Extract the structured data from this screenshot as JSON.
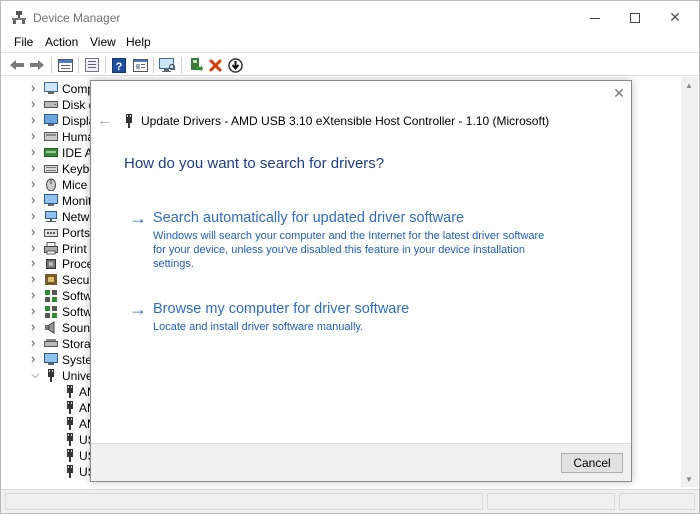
{
  "window": {
    "title": "Device Manager"
  },
  "menu": [
    "File",
    "Action",
    "View",
    "Help"
  ],
  "toolbar": {
    "icons": [
      "back-icon",
      "forward-icon",
      "properties-icon",
      "show-hidden-icon",
      "help-icon",
      "view-icon",
      "monitor-scan-icon",
      "enable-device-icon",
      "uninstall-icon",
      "update-driver-icon"
    ],
    "colors": {
      "uninstall": "#d83b01",
      "enable": "#2e8b2e",
      "help": "#1f4e9c"
    }
  },
  "tree": {
    "items": [
      {
        "label": "Comp",
        "icon": "computer-icon",
        "expanded": false
      },
      {
        "label": "Disk d",
        "icon": "disk-icon",
        "expanded": false
      },
      {
        "label": "Displa",
        "icon": "display-icon",
        "expanded": false
      },
      {
        "label": "Huma",
        "icon": "hid-icon",
        "expanded": false
      },
      {
        "label": "IDE AT",
        "icon": "ide-icon",
        "expanded": false
      },
      {
        "label": "Keybo",
        "icon": "keyboard-icon",
        "expanded": false
      },
      {
        "label": "Mice a",
        "icon": "mouse-icon",
        "expanded": false
      },
      {
        "label": "Monit",
        "icon": "monitor-icon",
        "expanded": false
      },
      {
        "label": "Netwo",
        "icon": "network-icon",
        "expanded": false
      },
      {
        "label": "Ports (",
        "icon": "port-icon",
        "expanded": false
      },
      {
        "label": "Print q",
        "icon": "printer-icon",
        "expanded": false
      },
      {
        "label": "Proces",
        "icon": "processor-icon",
        "expanded": false
      },
      {
        "label": "Securi",
        "icon": "security-icon",
        "expanded": false
      },
      {
        "label": "Softwa",
        "icon": "software-icon",
        "expanded": false
      },
      {
        "label": "Softwa",
        "icon": "software-icon",
        "expanded": false
      },
      {
        "label": "Sound",
        "icon": "sound-icon",
        "expanded": false
      },
      {
        "label": "Storag",
        "icon": "storage-icon",
        "expanded": false
      },
      {
        "label": "System",
        "icon": "system-icon",
        "expanded": false
      },
      {
        "label": "Univer",
        "icon": "usb-icon",
        "expanded": true
      }
    ],
    "children": [
      "AM",
      "AM",
      "AM",
      "US",
      "US",
      "US"
    ]
  },
  "dialog": {
    "title": "Update Drivers - AMD USB 3.10 eXtensible Host Controller - 1.10 (Microsoft)",
    "heading": "How do you want to search for drivers?",
    "options": [
      {
        "title": "Search automatically for updated driver software",
        "description": "Windows will search your computer and the Internet for the latest driver software for your device, unless you've disabled this feature in your device installation settings."
      },
      {
        "title": "Browse my computer for driver software",
        "description": "Locate and install driver software manually."
      }
    ],
    "cancel_label": "Cancel",
    "link_color": "#2d6ec4",
    "heading_color": "#1e3d8f"
  }
}
